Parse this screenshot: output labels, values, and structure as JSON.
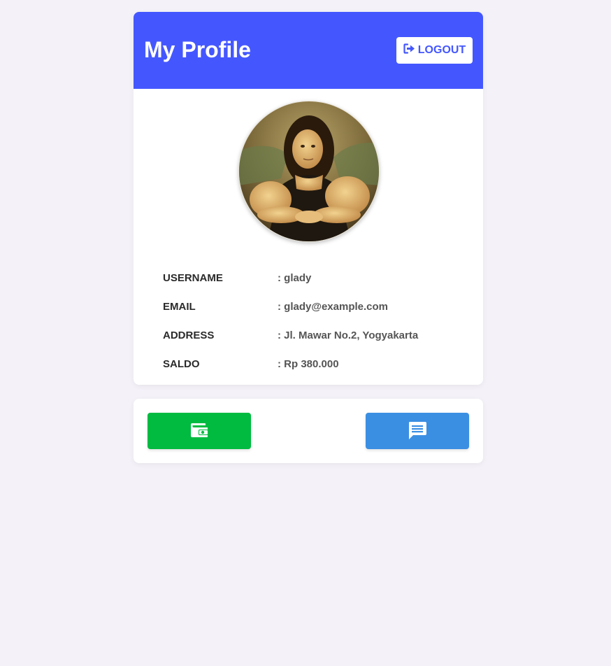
{
  "header": {
    "title": "My Profile",
    "logout_label": "LOGOUT",
    "logout_icon": "sign-out-icon"
  },
  "avatar": {
    "alt": "Profile picture"
  },
  "profile": {
    "fields": [
      {
        "label": "USERNAME",
        "value": ": glady"
      },
      {
        "label": "EMAIL",
        "value": ": glady@example.com"
      },
      {
        "label": "ADDRESS",
        "value": ": Jl. Mawar No.2, Yogyakarta"
      },
      {
        "label": "SALDO",
        "value": ": Rp 380.000"
      }
    ]
  },
  "actions": {
    "wallet_icon": "wallet-icon",
    "chat_icon": "chat-icon"
  },
  "colors": {
    "header": "#4457ff",
    "wallet_button": "#00bb40",
    "chat_button": "#3b8fe3",
    "background": "#f4f2f8"
  }
}
